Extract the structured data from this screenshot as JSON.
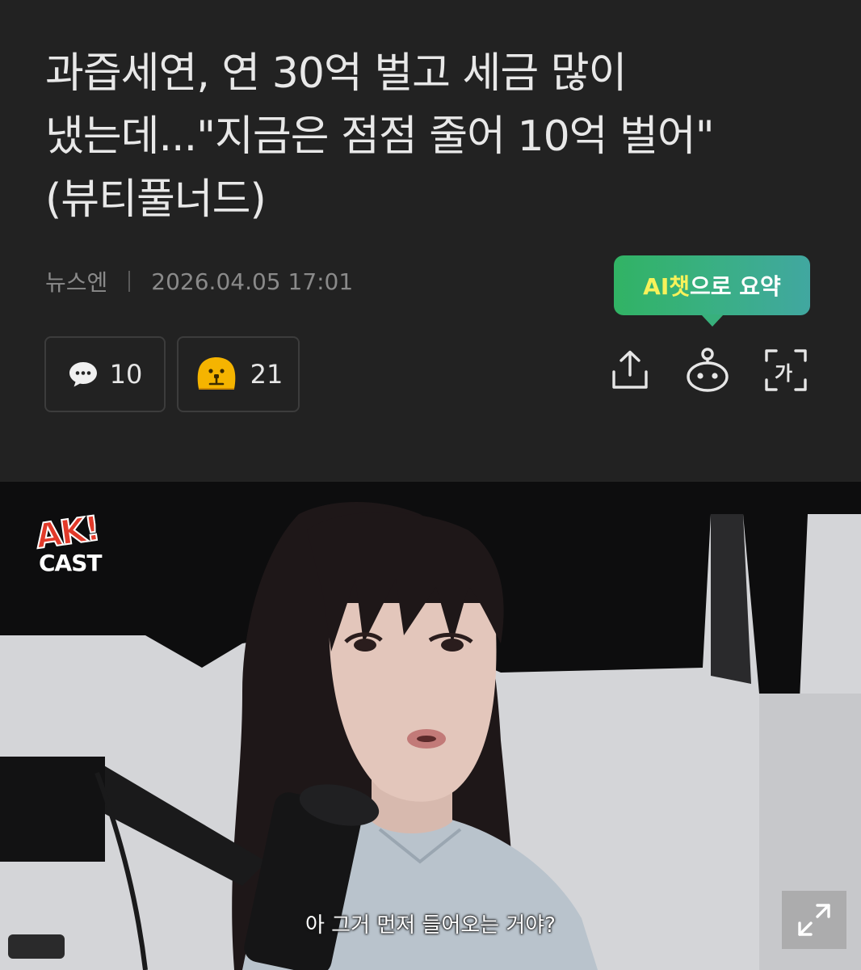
{
  "article": {
    "headline": "과즙세연, 연 30억 벌고 세금 많이 냈는데...\"지금은 점점 줄어 10억 벌어\"(뷰티풀너드)",
    "source": "뉴스엔",
    "datetime": "2026.04.05 17:01"
  },
  "ai_summary": {
    "highlight": "AI챗",
    "rest": "으로 요약"
  },
  "reactions": {
    "comment_count": "10",
    "emoji_count": "21"
  },
  "video": {
    "logo_line1": "AK!",
    "logo_line2": "CAST",
    "caption": "아 그거 먼저 들어오는 거야?"
  },
  "icons": {
    "comment": "speech-bubble-icon",
    "emoji": "emoji-face-icon",
    "share": "share-icon",
    "bot": "ai-bot-icon",
    "font": "font-size-icon",
    "expand": "expand-icon"
  },
  "colors": {
    "background": "#222222",
    "tooltip_start": "#31b364",
    "tooltip_end": "#41a7a0",
    "tooltip_highlight": "#f7f25a",
    "emoji_yellow": "#f5b400"
  }
}
